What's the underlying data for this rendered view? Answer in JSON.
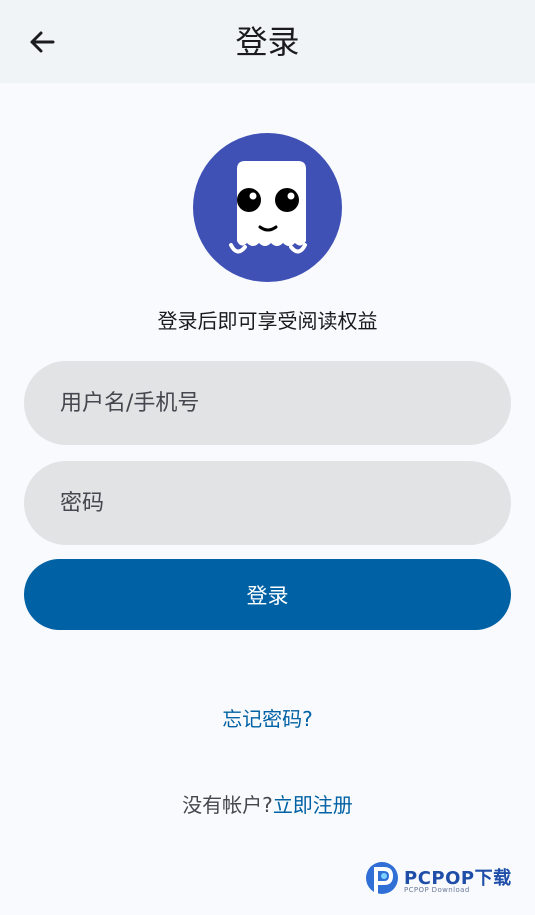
{
  "header": {
    "title": "登录",
    "back_icon": "arrow-left-icon"
  },
  "logo": {
    "icon": "ghost-mascot-icon",
    "bg_color": "#3f51b5"
  },
  "tagline": "登录后即可享受阅读权益",
  "form": {
    "username_placeholder": "用户名/手机号",
    "username_value": "",
    "password_placeholder": "密码",
    "password_value": "",
    "login_label": "登录"
  },
  "forgot_password": "忘记密码?",
  "register": {
    "question": "没有帐户?",
    "link": "立即注册"
  },
  "watermark": {
    "brand": "PCPOP下载",
    "sub": "PCPOP Download"
  },
  "colors": {
    "accent": "#0061a4",
    "field_bg": "#e2e3e5",
    "header_bg": "#f1f4f7"
  }
}
